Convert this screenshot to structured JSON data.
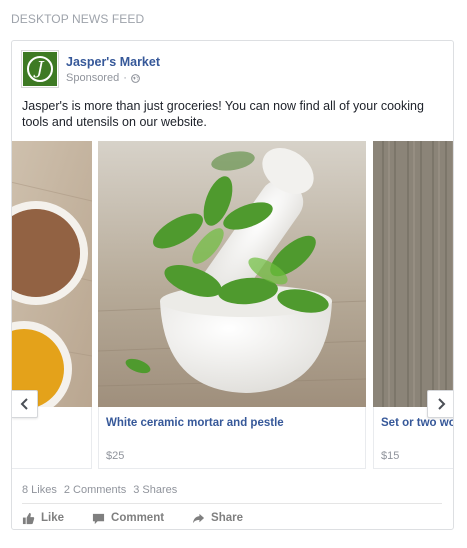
{
  "section_label": "DESKTOP NEWS FEED",
  "post": {
    "page_name": "Jasper's Market",
    "sponsored": "Sponsored",
    "separator": "·",
    "text": "Jasper's is more than just groceries! You can now find all of your cooking tools and utensils on our website.",
    "avatar_letter": "J"
  },
  "carousel": {
    "items": [
      {
        "title": "",
        "price": ""
      },
      {
        "title": "White ceramic mortar and pestle",
        "price": "$25"
      },
      {
        "title": "Set or two wo",
        "price": "$15"
      }
    ],
    "prev_icon": "chevron-left-icon",
    "next_icon": "chevron-right-icon"
  },
  "stats": {
    "likes": "8 Likes",
    "comments": "2 Comments",
    "shares": "3 Shares"
  },
  "actions": {
    "like": "Like",
    "comment": "Comment",
    "share": "Share"
  },
  "colors": {
    "link": "#365899",
    "muted": "#90949c",
    "brand_green": "#3e7a24"
  }
}
